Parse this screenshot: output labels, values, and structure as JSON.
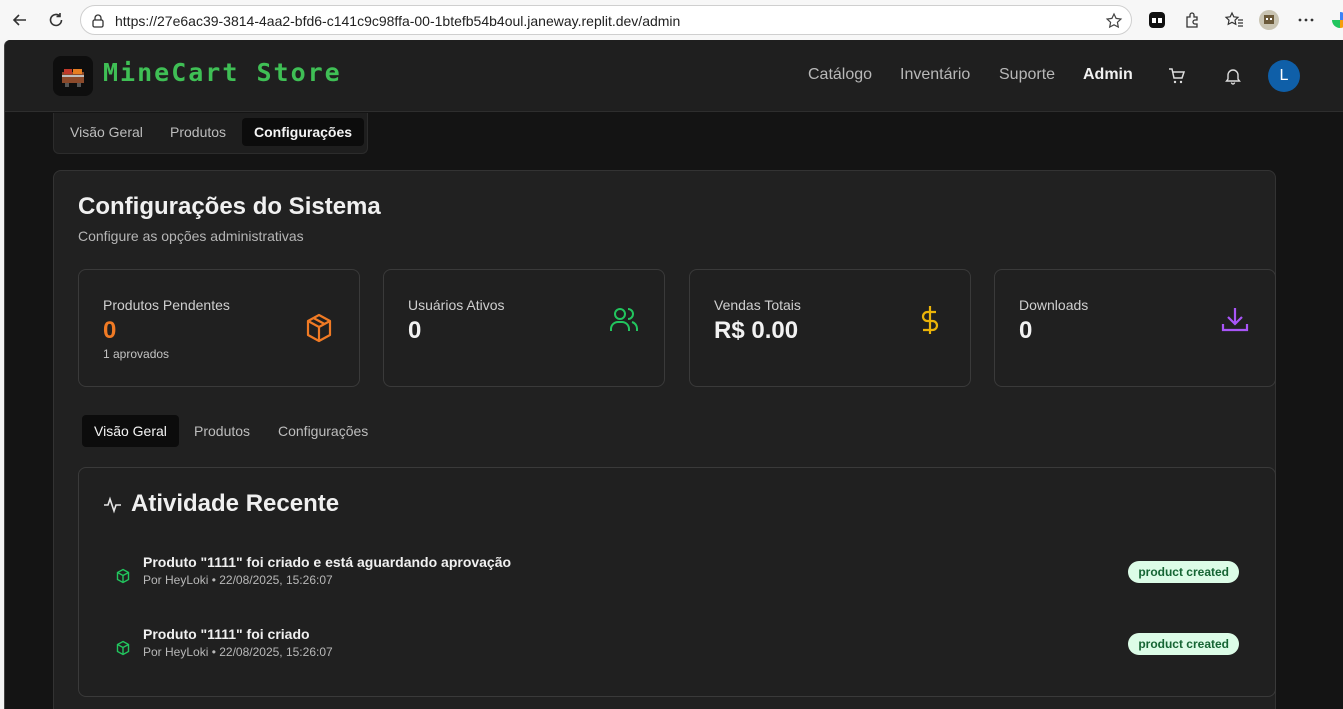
{
  "browser": {
    "url": "https://27e6ac39-3814-4aa2-bfd6-c141c9c98ffa-00-1btefb54b4oul.janeway.replit.dev/admin"
  },
  "app": {
    "brand": "MineCart Store",
    "nav": [
      "Catálogo",
      "Inventário",
      "Suporte",
      "Admin"
    ],
    "avatar_initial": "L"
  },
  "top_tabs": [
    "Visão Geral",
    "Produtos",
    "Configurações"
  ],
  "settings": {
    "title": "Configurações do Sistema",
    "subtitle": "Configure as opções administrativas"
  },
  "stats": [
    {
      "label": "Produtos Pendentes",
      "value": "0",
      "note": "1 aprovados",
      "icon": "package-icon",
      "color": "#f07a24"
    },
    {
      "label": "Usuários Ativos",
      "value": "0",
      "icon": "users-icon",
      "color": "#22c55e"
    },
    {
      "label": "Vendas Totais",
      "value": "R$ 0.00",
      "icon": "dollar-icon",
      "color": "#eab308"
    },
    {
      "label": "Downloads",
      "value": "0",
      "icon": "download-icon",
      "color": "#a855f7"
    }
  ],
  "inner_tabs": [
    "Visão Geral",
    "Produtos",
    "Configurações"
  ],
  "activity": {
    "title": "Atividade Recente",
    "items": [
      {
        "title": "Produto \"1111\" foi criado e está aguardando aprovação",
        "meta": "Por HeyLoki • 22/08/2025, 15:26:07",
        "badge": "product created"
      },
      {
        "title": "Produto \"1111\" foi criado",
        "meta": "Por HeyLoki • 22/08/2025, 15:26:07",
        "badge": "product created"
      }
    ]
  }
}
